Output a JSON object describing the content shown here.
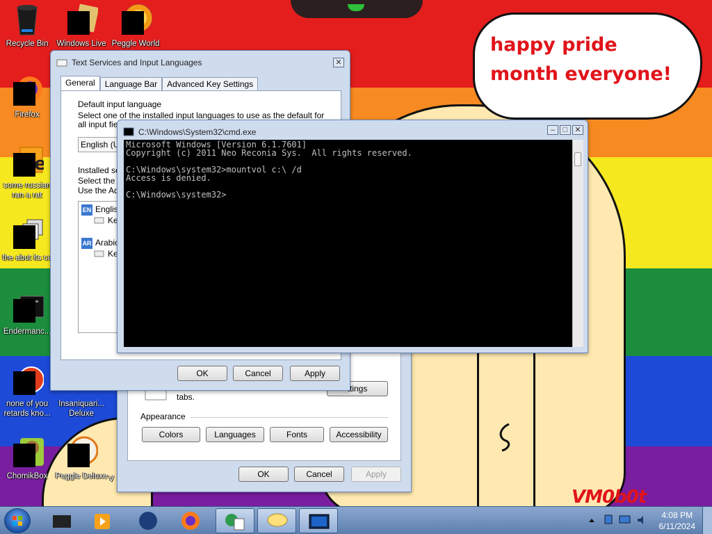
{
  "desktop": {
    "speech_bubble": "happy pride month everyone!",
    "watermark": "VM0b0t",
    "icons": [
      {
        "label": "Recycle Bin",
        "icon": "recycle-bin-icon"
      },
      {
        "label": "Windows Live",
        "icon": "folder-icon"
      },
      {
        "label": "Peggle World",
        "icon": "peggle-icon"
      },
      {
        "label": "Firefox",
        "icon": "firefox-icon"
      },
      {
        "label": "some russian ran a rat",
        "icon": "app-icon"
      },
      {
        "label": "the abut its ca",
        "icon": "stack-icon"
      },
      {
        "label": "Endermanc...",
        "icon": "console-icon"
      },
      {
        "label": "none of you retards kno...",
        "icon": "app-icon"
      },
      {
        "label": "Insaniquari... Deluxe",
        "icon": "game-icon"
      },
      {
        "label": "ChomikBox",
        "icon": "chomikbox-icon"
      },
      {
        "label": "Peggle Deluxe",
        "icon": "peggle-icon"
      },
      {
        "label": "V",
        "icon": "app-icon"
      }
    ]
  },
  "text_services": {
    "title": "Text Services and Input Languages",
    "tabs": [
      "General",
      "Language Bar",
      "Advanced Key Settings"
    ],
    "default_group": "Default input language",
    "default_desc": "Select one of the installed input languages to use as the default for all input fields.",
    "combo_value": "English (Ur",
    "installed_group": "Installed ser",
    "installed_desc_1": "Select the s",
    "installed_desc_2": "Use the Add",
    "tree": [
      {
        "badge": "EN",
        "label": "English"
      },
      {
        "badge": "AR",
        "label": "Arabic"
      }
    ],
    "tree_child": "Ke",
    "buttons": {
      "ok": "OK",
      "cancel": "Cancel",
      "apply": "Apply"
    }
  },
  "region_dialog": {
    "tabs_text": "tabs.",
    "settings_button": "ttings",
    "appearance_label": "Appearance",
    "appearance_buttons": [
      "Colors",
      "Languages",
      "Fonts",
      "Accessibility"
    ],
    "buttons": {
      "ok": "OK",
      "cancel": "Cancel",
      "apply": "Apply"
    }
  },
  "cmd": {
    "title": "C:\\Windows\\System32\\cmd.exe",
    "lines": [
      "Microsoft Windows [Version 6.1.7601]",
      "Copyright (c) 2011 Neo Reconia Sys.  All rights reserved.",
      "",
      "C:\\Windows\\system32>mountvol c:\\ /d",
      "Access is denied.",
      "",
      "C:\\Windows\\system32>"
    ]
  },
  "taskbar": {
    "items": [
      "start-orb",
      "app",
      "media-player",
      "globe",
      "firefox",
      "control-panel",
      "chat",
      "cmd"
    ],
    "time": "4:08 PM",
    "date": "6/11/2024"
  }
}
